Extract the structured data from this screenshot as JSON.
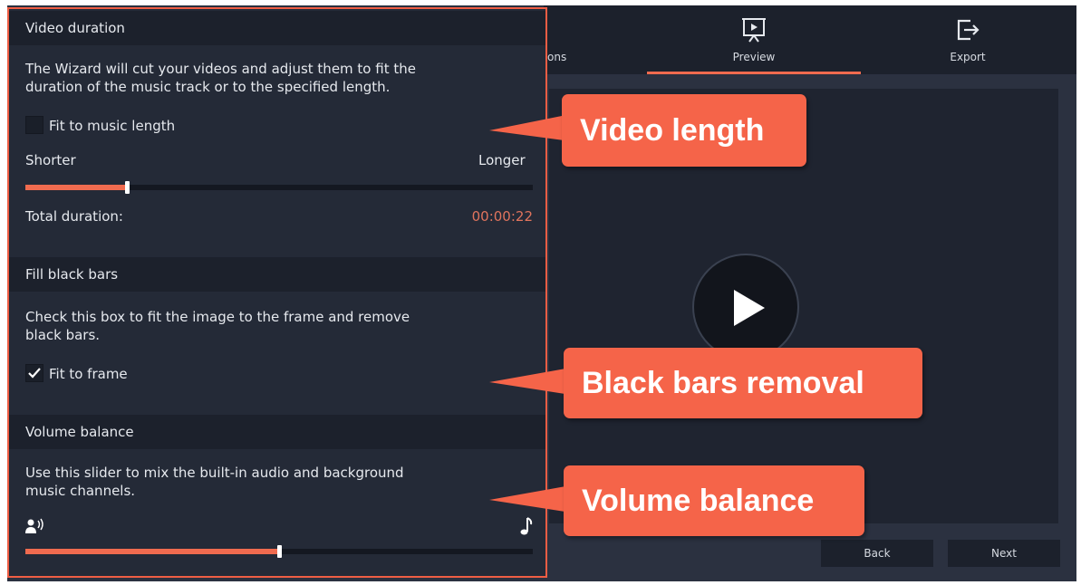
{
  "toolbar": {
    "options_label": "ons",
    "preview_label": "Preview",
    "export_label": "Export",
    "icons": {
      "preview": "presentation-play-icon",
      "export": "export-exit-icon"
    }
  },
  "player": {
    "play_icon": "play-icon"
  },
  "navigation": {
    "back_label": "Back",
    "next_label": "Next"
  },
  "panel": {
    "video_duration": {
      "header": "Video duration",
      "description_line1": "The Wizard will cut your videos and adjust them to fit the",
      "description_line2": "duration of the music track or to the specified length.",
      "checkbox_label": "Fit to music length",
      "checkbox_checked": false,
      "slider_left_label": "Shorter",
      "slider_right_label": "Longer",
      "slider_level": 0.2,
      "total_label": "Total duration:",
      "total_value": "00:00:22"
    },
    "fill_black_bars": {
      "header": "Fill black bars",
      "description_line1": "Check this box to fit the image to the frame and remove",
      "description_line2": "black bars.",
      "checkbox_label": "Fit to frame",
      "checkbox_checked": true
    },
    "volume_balance": {
      "header": "Volume balance",
      "description_line1": "Use this slider to mix the built-in audio and background",
      "description_line2": "music channels.",
      "left_icon": "speaking-person-icon",
      "right_icon": "music-note-icon",
      "slider_level": 0.5
    }
  },
  "callouts": {
    "video_length": "Video length",
    "black_bars_removal": "Black bars removal",
    "volume_balance": "Volume balance"
  },
  "colors": {
    "accent": "#f06b4f",
    "callout": "#f56449",
    "panel_bg": "#242a37",
    "header_bg": "#1c212c",
    "app_bg": "#2b3140"
  }
}
